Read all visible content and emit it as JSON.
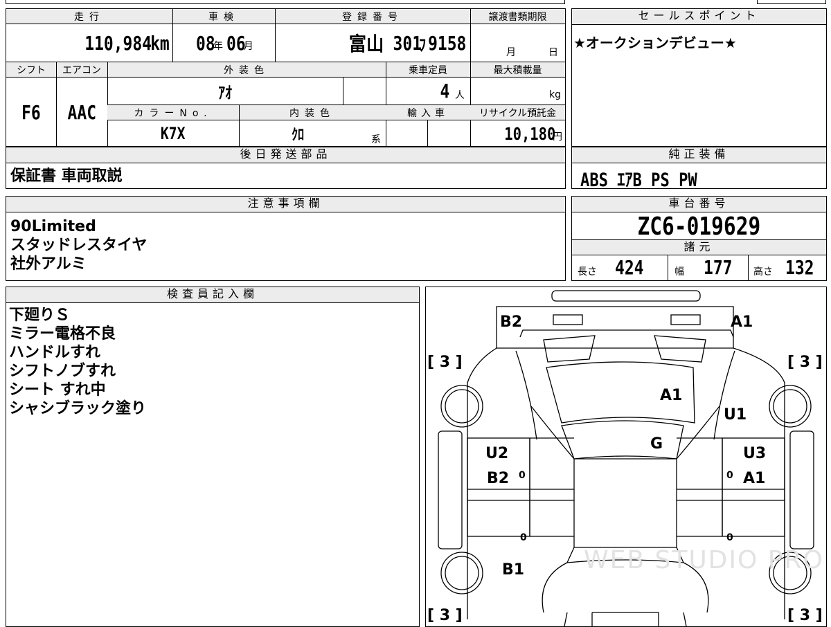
{
  "mileage": {
    "header": "走行",
    "value": "110,984",
    "unit": "km"
  },
  "inspection": {
    "header": "車検",
    "year": "08",
    "year_unit": "年",
    "month": "06",
    "month_unit": "月"
  },
  "registration": {
    "header": "登録番号",
    "region": "富山",
    "class": "301",
    "kana": "ﾌ",
    "number": "9158"
  },
  "transfer_deadline": {
    "header": "譲渡書類期限",
    "month_unit": "月",
    "day_unit": "日"
  },
  "shift": {
    "header": "シフト",
    "value": "F6"
  },
  "aircon": {
    "header": "エアコン",
    "value": "AAC"
  },
  "exterior_color": {
    "header": "外装色",
    "value": "ｱｵ"
  },
  "capacity": {
    "header": "乗車定員",
    "value": "4",
    "unit": "人"
  },
  "max_load": {
    "header": "最大積載量",
    "unit": "kg"
  },
  "color_no": {
    "header": "カラーNo.",
    "value": "K7X"
  },
  "interior_color": {
    "header": "内装色",
    "value": "ｸﾛ",
    "suffix": "系"
  },
  "import": {
    "header": "輸入車"
  },
  "recycle_fee": {
    "header": "リサイクル預託金",
    "value": "10,180",
    "unit": "円"
  },
  "sales_point": {
    "header": "セールスポイント",
    "text": "★オークションデビュー★"
  },
  "later_parts": {
    "header": "後日発送部品",
    "text": "保証書 車両取説"
  },
  "genuine_equipment": {
    "header": "純正装備",
    "text": "ABS ｴｱB PS PW"
  },
  "notes": {
    "header": "注意事項欄",
    "lines": [
      "90Limited",
      "スタッドレスタイヤ",
      "社外アルミ"
    ]
  },
  "chassis": {
    "header": "車台番号",
    "value": "ZC6-019629"
  },
  "specs": {
    "header": "諸元",
    "length_label": "長さ",
    "length": "424",
    "width_label": "幅",
    "width": "177",
    "height_label": "高さ",
    "height": "132"
  },
  "inspector": {
    "header": "検査員記入欄",
    "lines": [
      "下廻りＳ",
      "ミラー電格不良",
      "ハンドルすれ",
      "シフトノブすれ",
      "シート すれ中",
      "シャシブラック塗り"
    ]
  },
  "diagram": {
    "tire_tl": "[ 3 ]",
    "tire_tr": "[ 3 ]",
    "tire_bl": "[ 3 ]",
    "tire_br": "[ 3 ]",
    "marks": {
      "b2_top": "B2",
      "a1_top": "A1",
      "a1_hood": "A1",
      "u1": "U1",
      "g": "G",
      "u2": "U2",
      "u3": "U3",
      "b2_left": "B2",
      "a1_right": "A1",
      "b1": "B1"
    },
    "zeros": [
      "0",
      "0",
      "0",
      "0"
    ],
    "watermark": "WEB STUDIO PRO"
  }
}
